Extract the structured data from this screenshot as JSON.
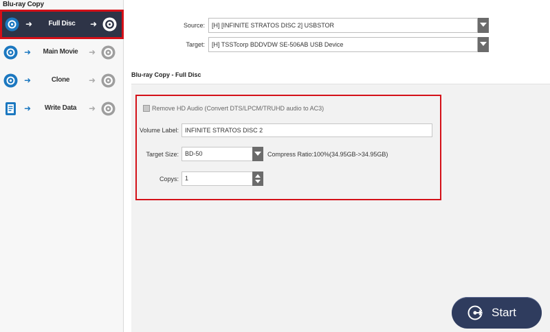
{
  "sidebar": {
    "title": "Blu-ray Copy",
    "items": [
      {
        "label": "Full Disc",
        "active": true
      },
      {
        "label": "Main Movie",
        "active": false
      },
      {
        "label": "Clone",
        "active": false
      },
      {
        "label": "Write Data",
        "active": false
      }
    ]
  },
  "source": {
    "label": "Source:",
    "value": "[H] [INFINITE STRATOS DISC 2] USBSTOR"
  },
  "target": {
    "label": "Target:",
    "value": "[H] TSSTcorp BDDVDW SE-506AB USB Device"
  },
  "panel": {
    "title": "Blu-ray Copy - Full Disc",
    "remove_hd_audio": {
      "label": "Remove HD Audio (Convert DTS/LPCM/TRUHD audio to AC3)",
      "checked": false,
      "disabled": true
    },
    "volume_label": {
      "label": "Volume Label:",
      "value": "INFINITE STRATOS DISC 2"
    },
    "target_size": {
      "label": "Target Size:",
      "value": "BD-50"
    },
    "compress_ratio": "Compress Ratio:100%(34.95GB->34.95GB)",
    "copys": {
      "label": "Copys:",
      "value": "1"
    }
  },
  "start_button": {
    "label": "Start"
  },
  "colors": {
    "accent_dark": "#2e3447",
    "highlight_red": "#d41018",
    "icon_blue": "#1c78c0",
    "start_bg": "#2f3c5e"
  },
  "icons": {
    "source": "disc-source-icon",
    "write_data": "document-icon",
    "target": "disc-target-icon",
    "start": "start-icon",
    "dropdown": "chevron-down-icon",
    "spinner": "spinner-arrows-icon"
  }
}
